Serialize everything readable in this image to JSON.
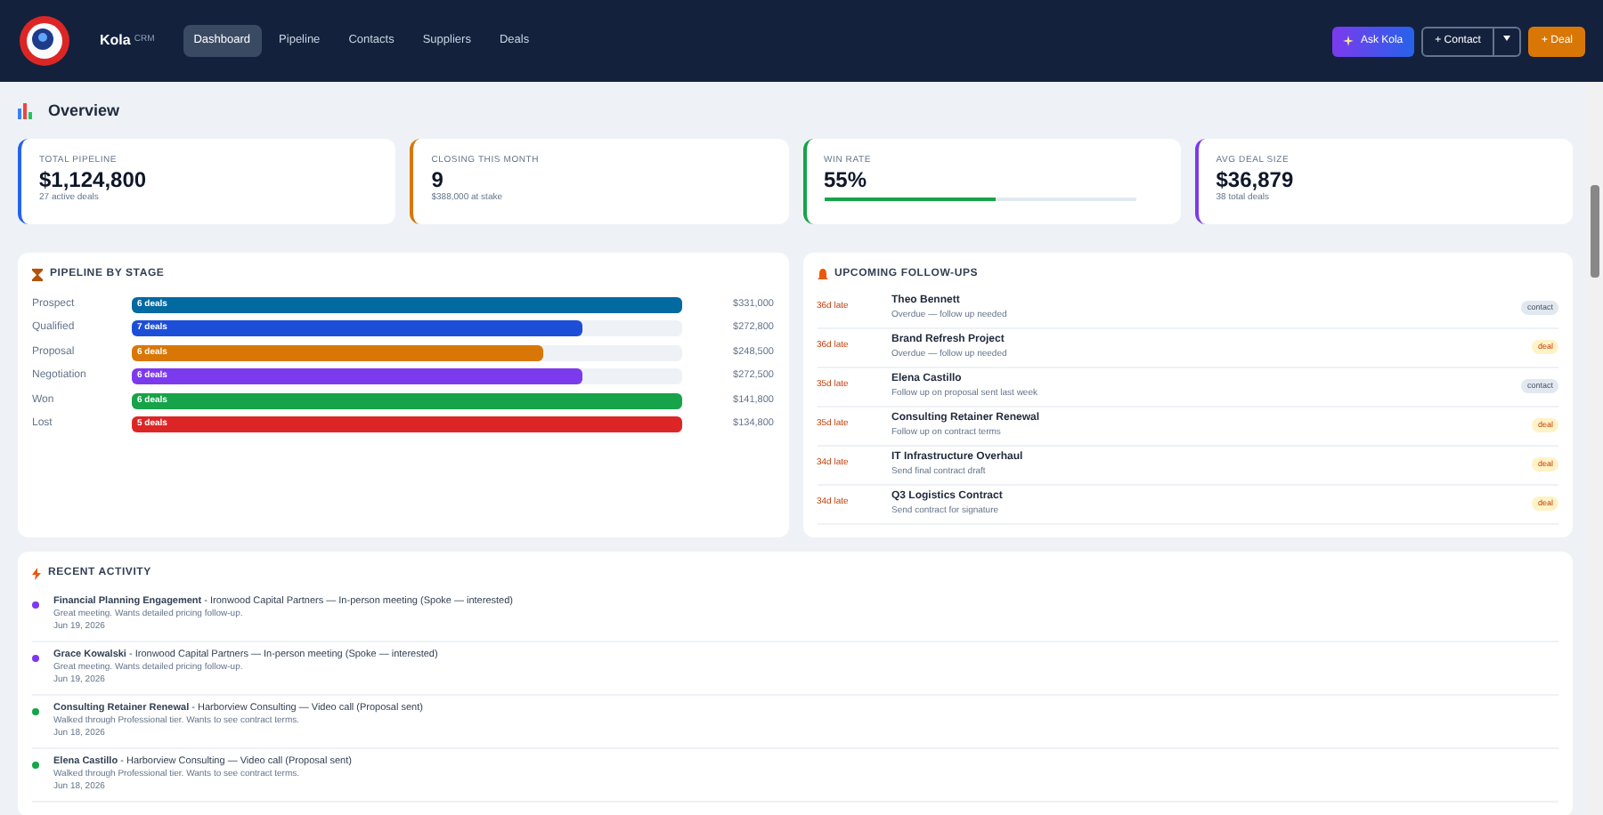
{
  "brand": {
    "name": "Kola",
    "tag": "CRM"
  },
  "nav": [
    {
      "label": "Dashboard",
      "selected": true
    },
    {
      "label": "Pipeline",
      "selected": false
    },
    {
      "label": "Contacts",
      "selected": false
    },
    {
      "label": "Suppliers",
      "selected": false
    },
    {
      "label": "Deals",
      "selected": false
    }
  ],
  "actions": {
    "ask": "Ask Kola",
    "contact": "+ Contact",
    "deal": "+ Deal"
  },
  "page_title": "Overview",
  "kpis": [
    {
      "label": "TOTAL PIPELINE",
      "value": "$1,124,800",
      "note": "27 active deals",
      "color": "#2563eb"
    },
    {
      "label": "CLOSING THIS MONTH",
      "value": "9",
      "note": "$388,000 at stake",
      "color": "#d97706"
    },
    {
      "label": "WIN RATE",
      "value": "55%",
      "level": 0.55,
      "color": "#16a34a"
    },
    {
      "label": "AVG DEAL SIZE",
      "value": "$36,879",
      "note": "38 total deals",
      "color": "#7c3aed"
    }
  ],
  "pipeline": {
    "title": "PIPELINE BY STAGE",
    "stages": [
      {
        "name": "Prospect",
        "count": "6 deals",
        "level": 1.0,
        "amount": "$331,000",
        "color": "#0369a1"
      },
      {
        "name": "Qualified",
        "count": "7 deals",
        "level": 0.82,
        "amount": "$272,800",
        "color": "#1d4ed8"
      },
      {
        "name": "Proposal",
        "count": "6 deals",
        "level": 0.75,
        "amount": "$248,500",
        "color": "#d97706"
      },
      {
        "name": "Negotiation",
        "count": "6 deals",
        "level": 0.82,
        "amount": "$272,500",
        "color": "#7c3aed"
      },
      {
        "name": "Won",
        "count": "6 deals",
        "level": 1.0,
        "amount": "$141,800",
        "color": "#16a34a"
      },
      {
        "name": "Lost",
        "count": "5 deals",
        "level": 1.0,
        "amount": "$134,800",
        "color": "#dc2626"
      }
    ]
  },
  "followups": {
    "title": "UPCOMING FOLLOW-UPS",
    "items": [
      {
        "late": "36d late",
        "name": "Theo Bennett",
        "note": "Overdue — follow up needed",
        "tag": "contact",
        "kind": "contact"
      },
      {
        "late": "36d late",
        "name": "Brand Refresh Project",
        "note": "Overdue — follow up needed",
        "tag": "deal",
        "kind": "deal"
      },
      {
        "late": "35d late",
        "name": "Elena Castillo",
        "note": "Follow up on proposal sent last week",
        "tag": "contact",
        "kind": "contact"
      },
      {
        "late": "35d late",
        "name": "Consulting Retainer Renewal",
        "note": "Follow up on contract terms",
        "tag": "deal",
        "kind": "deal"
      },
      {
        "late": "34d late",
        "name": "IT Infrastructure Overhaul",
        "note": "Send final contract draft",
        "tag": "deal",
        "kind": "deal"
      },
      {
        "late": "34d late",
        "name": "Q3 Logistics Contract",
        "note": "Send contract for signature",
        "tag": "deal",
        "kind": "deal"
      }
    ]
  },
  "activity": {
    "title": "RECENT ACTIVITY",
    "items": [
      {
        "text": "**Financial Planning Engagement** - Ironwood Capital Partners — In-person meeting (Spoke — interested)",
        "note": "Great meeting. Wants detailed pricing follow-up.",
        "date": "Jun 19, 2026",
        "color": "#7c3aed"
      },
      {
        "text": "**Grace Kowalski** - Ironwood Capital Partners — In-person meeting (Spoke — interested)",
        "note": "Great meeting. Wants detailed pricing follow-up.",
        "date": "Jun 19, 2026",
        "color": "#7c3aed"
      },
      {
        "text": "**Consulting Retainer Renewal** - Harborview Consulting — Video call (Proposal sent)",
        "note": "Walked through Professional tier. Wants to see contract terms.",
        "date": "Jun 18, 2026",
        "color": "#16a34a"
      },
      {
        "text": "**Elena Castillo** - Harborview Consulting — Video call (Proposal sent)",
        "note": "Walked through Professional tier. Wants to see contract terms.",
        "date": "Jun 18, 2026",
        "color": "#16a34a"
      }
    ]
  }
}
